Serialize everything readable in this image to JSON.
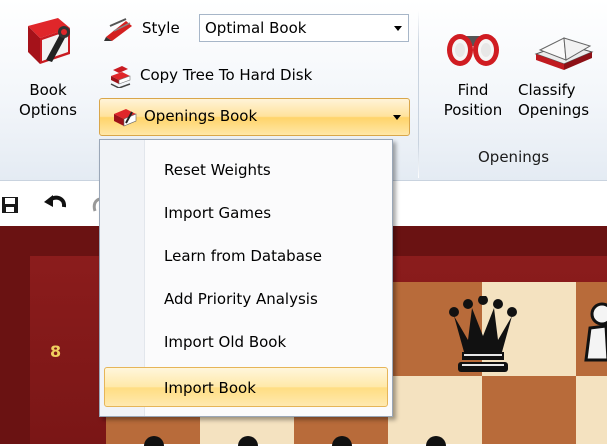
{
  "ribbon": {
    "book_options_line1": "Book",
    "book_options_line2": "Options",
    "style_label": "Style",
    "style_value": "Optimal Book",
    "copy_tree_label": "Copy Tree To Hard Disk",
    "openings_book_label": "Openings Book",
    "find_position_line1": "Find",
    "find_position_line2": "Position",
    "classify_line1": "Classify",
    "classify_line2": "Openings",
    "group_label": "Openings"
  },
  "menu": {
    "items": [
      {
        "label": "Reset Weights"
      },
      {
        "label": "Import Games"
      },
      {
        "label": "Learn from Database"
      },
      {
        "label": "Add Priority Analysis"
      },
      {
        "label": "Import Old Book"
      },
      {
        "label": "Import Book"
      }
    ],
    "highlighted": "Import Book"
  },
  "board": {
    "rank_label": "8"
  },
  "colors": {
    "highlight": "#ffe29c",
    "board_frame": "#7a1616",
    "light_square": "#f4e2c0",
    "dark_square": "#b86b3a"
  },
  "icons": {
    "book_options": "red-book-wrench-icon",
    "style": "red-pencil-style-icon",
    "copy_tree": "book-stack-copy-icon",
    "openings_book": "red-book-icon",
    "find_position": "binoculars-icon",
    "classify": "open-book-icon",
    "save": "save-icon",
    "undo": "undo-icon"
  }
}
